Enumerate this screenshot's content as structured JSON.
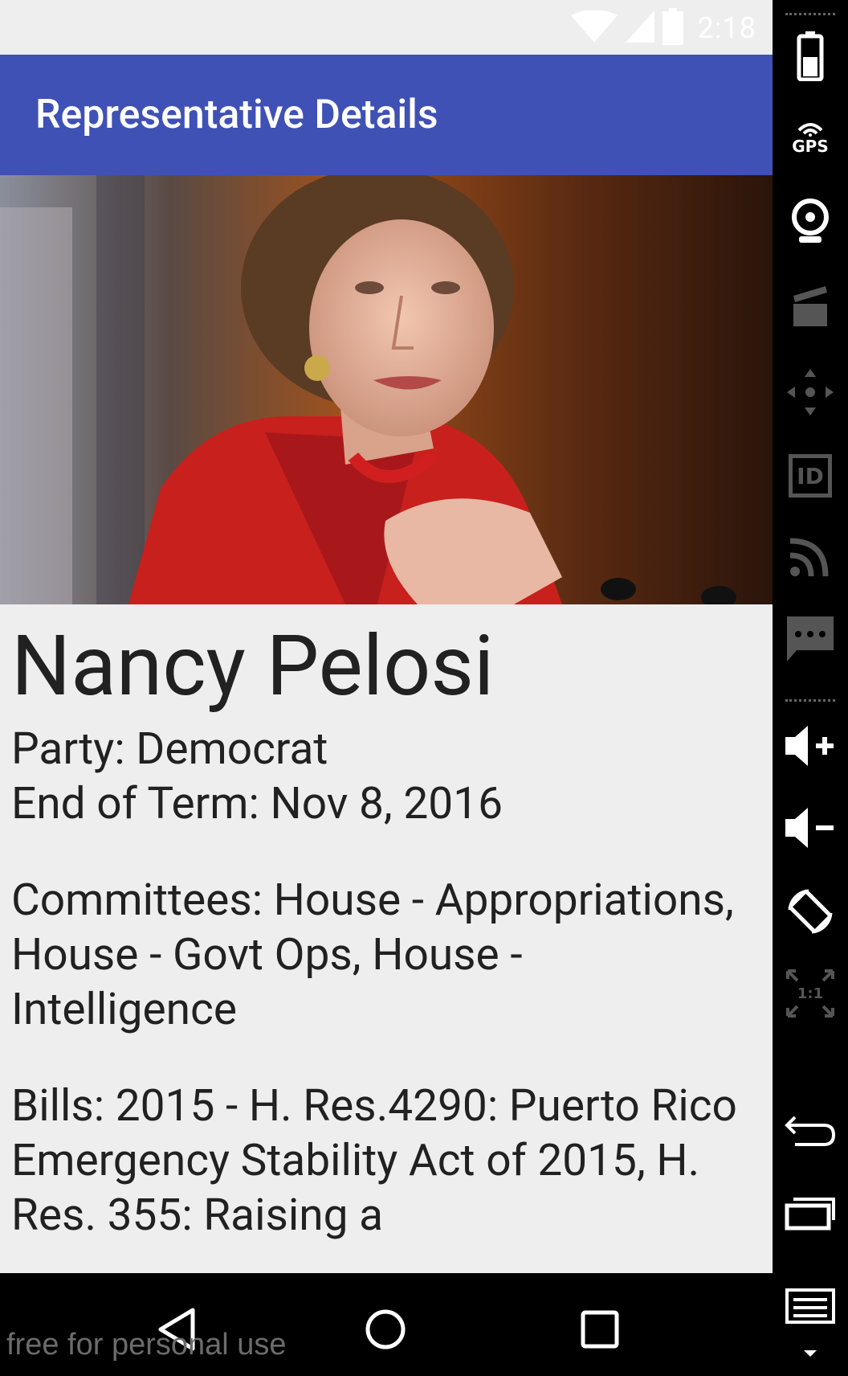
{
  "status_bar": {
    "time": "2:18"
  },
  "app_bar": {
    "title": "Representative Details"
  },
  "representative": {
    "name": "Nancy Pelosi",
    "party": "Party: Democrat",
    "end_of_term": "End of Term: Nov 8, 2016",
    "committees": "Committees: House - Appropriations, House - Govt Ops, House - Intelligence",
    "bills": "Bills: 2015 - H. Res.4290: Puerto Rico Emergency Stability Act of 2015, H. Res. 355: Raising a"
  },
  "nav_bar": {
    "back_icon": "back-icon",
    "home_icon": "home-icon",
    "recents_icon": "recents-icon"
  },
  "watermark": "free for personal use",
  "side_toolbar": {
    "gps_label": "GPS",
    "id_label": "ID",
    "ratio_label": "1:1",
    "icons": [
      "battery-icon",
      "gps-icon",
      "camera-icon",
      "clapperboard-icon",
      "move-icon",
      "id-icon",
      "rss-icon",
      "chat-icon",
      "volume-up-icon",
      "volume-down-icon",
      "rotate-icon",
      "fullscreen-icon",
      "back-arrow-icon",
      "recents-icon",
      "menu-icon"
    ]
  },
  "colors": {
    "app_bar": "#3f51b5",
    "background": "#eeeeee",
    "text": "#212121"
  }
}
